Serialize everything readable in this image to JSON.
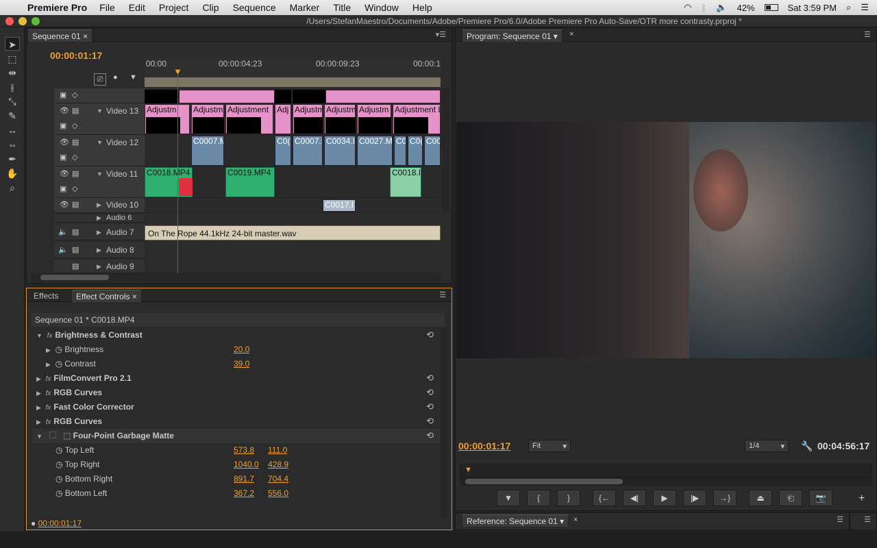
{
  "menubar": {
    "app": "Premiere Pro",
    "items": [
      "File",
      "Edit",
      "Project",
      "Clip",
      "Sequence",
      "Marker",
      "Title",
      "Window",
      "Help"
    ],
    "battery": "42%",
    "clock": "Sat 3:59 PM"
  },
  "titlebar": {
    "path": "/Users/StefanMaestro/Documents/Adobe/Premiere Pro/6.0/Adobe Premiere Pro Auto-Save/OTR more contrasty.prproj *"
  },
  "timeline": {
    "tab": "Sequence 01",
    "timecode": "00:00:01:17",
    "ruler": [
      "00:00",
      "00:00:04:23",
      "00:00:09:23",
      "00:00:1"
    ],
    "tracks": {
      "v13": "Video 13",
      "v12": "Video 12",
      "v11": "Video 11",
      "v10": "Video 10",
      "a6": "Audio 6",
      "a7": "Audio 7",
      "a8": "Audio 8",
      "a9": "Audio 9"
    },
    "clips": {
      "adj": [
        "Adjustm",
        "Adjustm",
        "Adjustment",
        "Adj",
        "Adjustm",
        "Adjustm",
        "Adjustm",
        "Adjustment L"
      ],
      "v12": [
        "C0007.M",
        "C0(",
        "C0007.I",
        "C0034.I",
        "C0027.M",
        "C0(",
        "C0(",
        "C00"
      ],
      "v11": [
        "C0018.MP4",
        "C0019.MP4",
        "C0018.I"
      ],
      "v10": "C0017.I",
      "audio": "On The Rope 44.1kHz 24-bit master.wav"
    }
  },
  "effects": {
    "tab_effects": "Effects",
    "tab_controls": "Effect Controls",
    "clip": "Sequence 01 * C0018.MP4",
    "bc": "Brightness & Contrast",
    "brightness_label": "Brightness",
    "brightness": "20.0",
    "contrast_label": "Contrast",
    "contrast": "39.0",
    "filmconvert": "FilmConvert Pro 2.1",
    "rgb1": "RGB Curves",
    "fcc": "Fast Color Corrector",
    "rgb2": "RGB Curves",
    "fpgm": "Four-Point Garbage Matte",
    "tl_label": "Top Left",
    "tl_x": "573.8",
    "tl_y": "111.0",
    "tr_label": "Top Right",
    "tr_x": "1040.0",
    "tr_y": "428.9",
    "br_label": "Bottom Right",
    "br_x": "891.7",
    "br_y": "704.4",
    "bl_label": "Bottom Left",
    "bl_x": "367.2",
    "bl_y": "556.0",
    "footer_tc": "00:00:01:17"
  },
  "program": {
    "tab": "Program: Sequence 01",
    "tc_current": "00:00:01:17",
    "fit": "Fit",
    "resolution": "1/4",
    "tc_duration": "00:04:56:17"
  },
  "reference": {
    "tab": "Reference: Sequence 01"
  },
  "colors": {
    "accent": "#f0a030",
    "adjustment": "#e592c8",
    "green_clip": "#2fb070",
    "playhead": "#d9312b"
  }
}
